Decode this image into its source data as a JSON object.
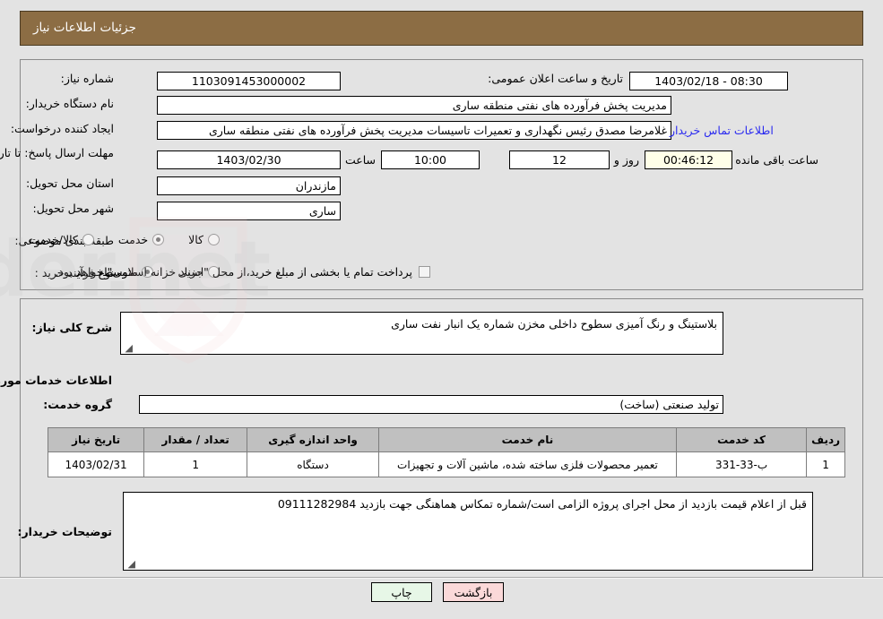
{
  "header": {
    "title": "جزئیات اطلاعات نیاز"
  },
  "top_panel": {
    "need_number_label": "شماره نیاز:",
    "need_number_value": "1103091453000002",
    "announce_datetime_label": "تاریخ و ساعت اعلان عمومی:",
    "announce_datetime_value": "08:30 - 1403/02/18",
    "buyer_org_label": "نام دستگاه خریدار:",
    "buyer_org_value": "مدیریت پخش فرآورده های نفتی منطقه ساری",
    "requester_label": "ایجاد کننده درخواست:",
    "requester_value": "غلامرضا مصدق رئیس نگهداری و تعمیرات تاسیسات مدیریت پخش فرآورده های نفتی منطقه ساری",
    "buyer_contact_link": "اطلاعات تماس خریدار",
    "deadline_label": "مهلت ارسال پاسخ: تا تاریخ:",
    "deadline_date": "1403/02/30",
    "hour_label": "ساعت",
    "deadline_time": "10:00",
    "days_value": "12",
    "days_label": "روز و",
    "countdown_value": "00:46:12",
    "remaining_label": "ساعت باقی مانده",
    "province_label": "استان محل تحویل:",
    "province_value": "مازندران",
    "city_label": "شهر محل تحویل:",
    "city_value": "ساری",
    "category_label": "طبقه بندی موضوعی:",
    "category_options": [
      {
        "label": "کالا",
        "selected": false
      },
      {
        "label": "خدمت",
        "selected": true
      },
      {
        "label": "کالا/خدمت",
        "selected": false
      }
    ],
    "process_label": "نوع فرآیند خرید :",
    "process_options": [
      {
        "label": "جزیی",
        "selected": false
      },
      {
        "label": "متوسط",
        "selected": true
      }
    ],
    "treasury_checkbox_checked": false,
    "treasury_text": "پرداخت تمام یا بخشی از مبلغ خرید،از محل \"اسناد خزانه اسلامی\" خواهد بود."
  },
  "main_panel": {
    "general_desc_label": "شرح کلی نیاز:",
    "general_desc_value": "بلاستینگ و رنگ آمیزی سطوح داخلی مخزن شماره یک انبار نفت ساری",
    "services_info_heading": "اطلاعات خدمات مورد نیاز",
    "service_group_label": "گروه خدمت:",
    "service_group_value": "تولید صنعتی (ساخت)",
    "table": {
      "columns": [
        "ردیف",
        "کد خدمت",
        "نام خدمت",
        "واحد اندازه گیری",
        "تعداد / مقدار",
        "تاریخ نیاز"
      ],
      "rows": [
        {
          "radif": "1",
          "code": "ب-33-331",
          "name": "تعمیر محصولات فلزی ساخته شده، ماشین آلات و تجهیزات",
          "unit": "دستگاه",
          "qty": "1",
          "date": "1403/02/31"
        }
      ]
    },
    "buyer_notes_label": "توضیحات خریدار:",
    "buyer_notes_value": "قبل از اعلام قیمت بازدید از محل اجرای پروژه الزامی است/شماره تمکاس هماهنگی جهت بازدید 09111282984"
  },
  "footer": {
    "print_label": "چاپ",
    "back_label": "بازگشت"
  },
  "watermark": {
    "text": "AnaTender.net"
  },
  "colors": {
    "header_bg": "#8c6d44",
    "page_bg": "#e3e3e3",
    "link": "#2a2af0",
    "table_header_bg": "#c0c0c0",
    "countdown_bg": "#ffffe8",
    "print_btn_bg": "#e7f7e7",
    "back_btn_bg": "#fbd9d9"
  }
}
